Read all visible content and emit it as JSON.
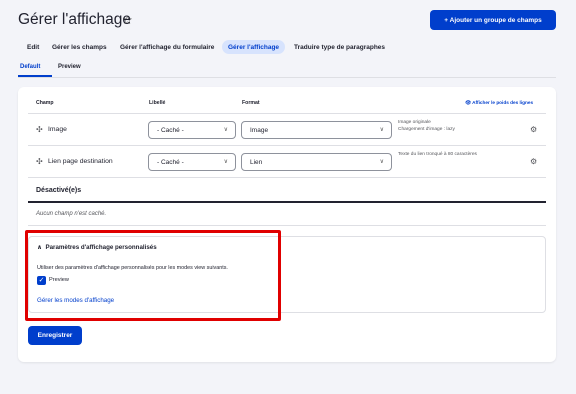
{
  "page": {
    "title": "Gérer l'affichage",
    "star_icon": "star-icon",
    "add_group_label": "+ Ajouter un groupe de champs"
  },
  "tabs": [
    {
      "label": "Edit",
      "active": false
    },
    {
      "label": "Gérer les champs",
      "active": false
    },
    {
      "label": "Gérer l'affichage du formulaire",
      "active": false
    },
    {
      "label": "Gérer l'affichage",
      "active": true
    },
    {
      "label": "Traduire type de paragraphes",
      "active": false
    }
  ],
  "subtabs": [
    {
      "label": "Default",
      "active": true
    },
    {
      "label": "Preview",
      "active": false
    }
  ],
  "table": {
    "headers": {
      "champ": "Champ",
      "libelle": "Libellé",
      "format": "Format"
    },
    "show_weights": "Afficher le poids des lignes",
    "rows": [
      {
        "name": "Image",
        "label_select": "- Caché -",
        "format_select": "Image",
        "summary_line1": "Image originale",
        "summary_line2": "Chargement d'image : lazy"
      },
      {
        "name": "Lien page destination",
        "label_select": "- Caché -",
        "format_select": "Lien",
        "summary_line1": "Texte du lien tronqué à 80 caractères",
        "summary_line2": ""
      }
    ],
    "disabled_title": "Désactivé(e)s",
    "disabled_empty": "Aucun champ n'est caché."
  },
  "custom_settings": {
    "title": "Paramètres d'affichage personnalisés",
    "description": "Utiliser des paramètres d'affichage personnalisés pour les modes view suivants.",
    "checkbox_label": "Preview",
    "checkbox_checked": true,
    "manage_link": "Gérer les modes d'affichage"
  },
  "actions": {
    "save_label": "Enregistrer"
  },
  "colors": {
    "accent": "#003ecc",
    "highlight_box": "#e00000"
  }
}
